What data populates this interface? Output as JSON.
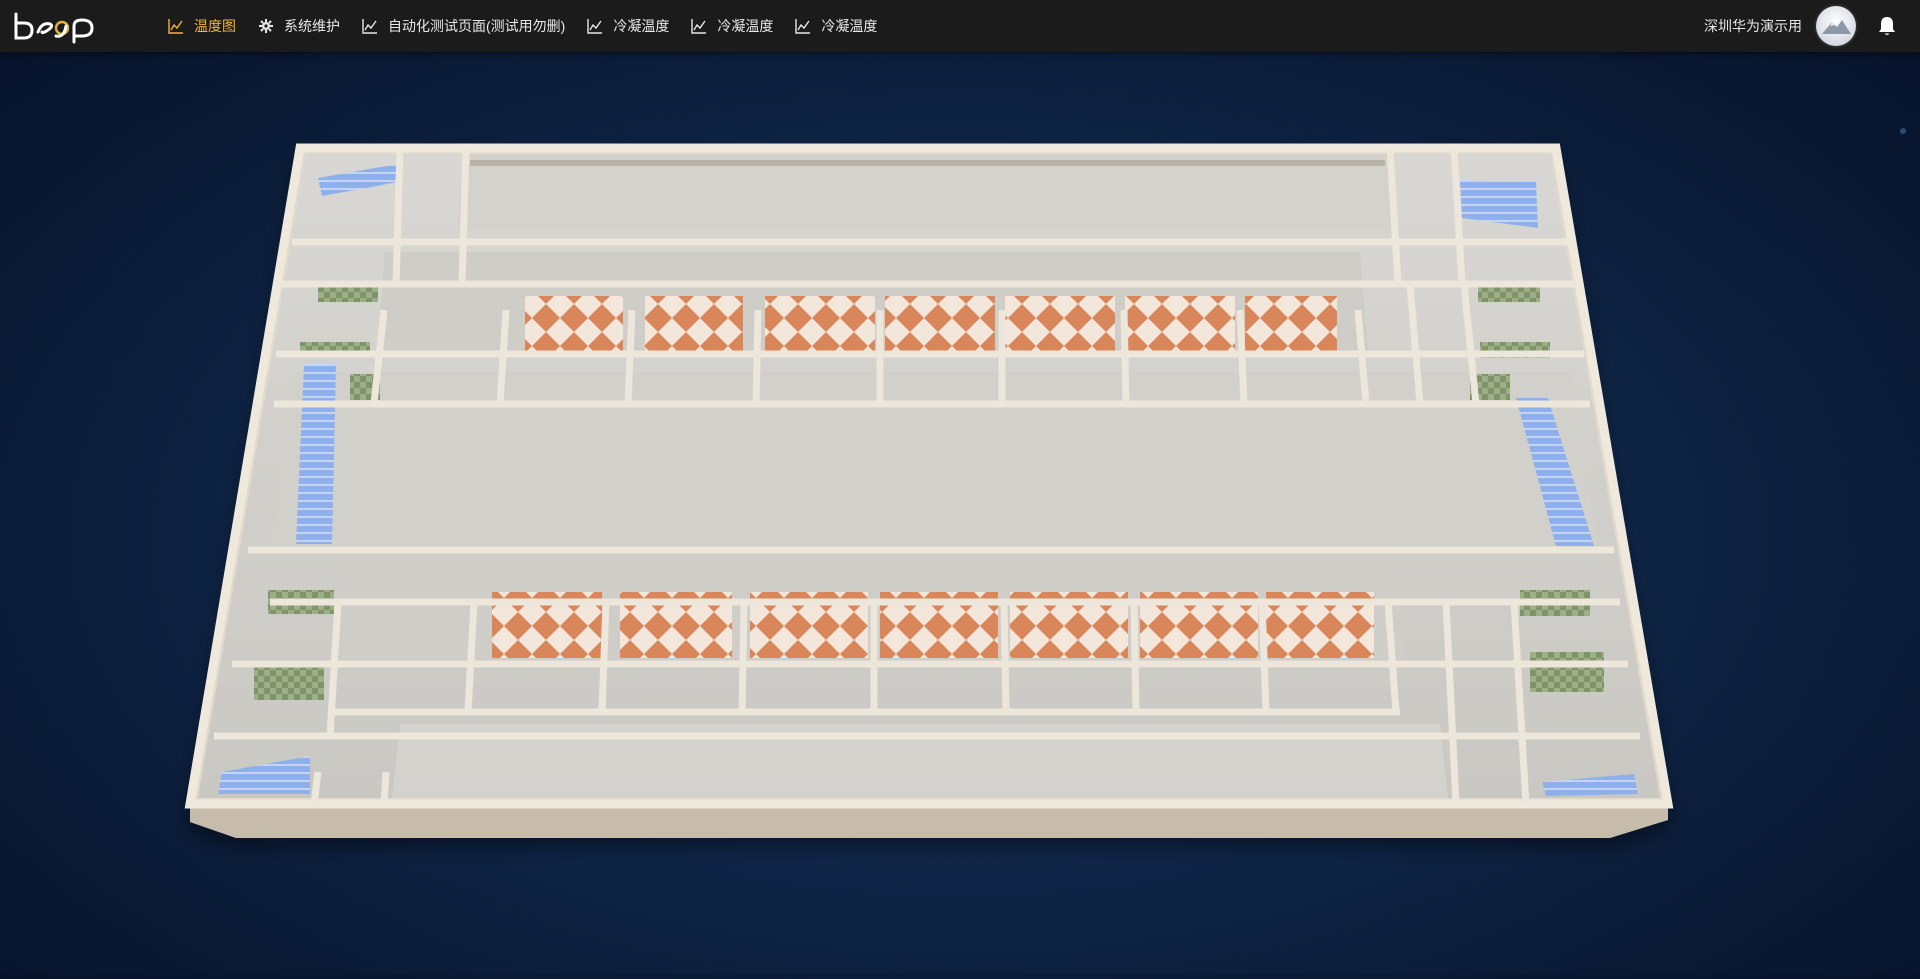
{
  "header": {
    "logo_text": "beyp",
    "nav": [
      {
        "label": "温度图",
        "icon": "line-chart-icon",
        "active": true
      },
      {
        "label": "系统维护",
        "icon": "gear-icon",
        "active": false
      },
      {
        "label": "自动化测试页面(测试用勿删)",
        "icon": "line-chart-icon",
        "active": false
      },
      {
        "label": "冷凝温度",
        "icon": "line-chart-icon",
        "active": false
      },
      {
        "label": "冷凝温度",
        "icon": "line-chart-icon",
        "active": false
      },
      {
        "label": "冷凝温度",
        "icon": "line-chart-icon",
        "active": false
      }
    ],
    "user_name": "深圳华为演示用",
    "avatar_icon": "avatar-mountain-icon",
    "bell_icon": "bell-icon"
  },
  "colors": {
    "topbar": "#1b1b1b",
    "active_nav": "#f2b632",
    "nav_text": "#e8e8e8",
    "background": "#0f2547",
    "wall": "#ddd3c4",
    "floor": "#d9d9d6",
    "tile_orange": "#d9875a",
    "tile_light": "#f3e7dc",
    "stairs": "#7ea1e0"
  },
  "scene": {
    "type": "3d-floor-plan",
    "icon": "building-floor-plan"
  }
}
